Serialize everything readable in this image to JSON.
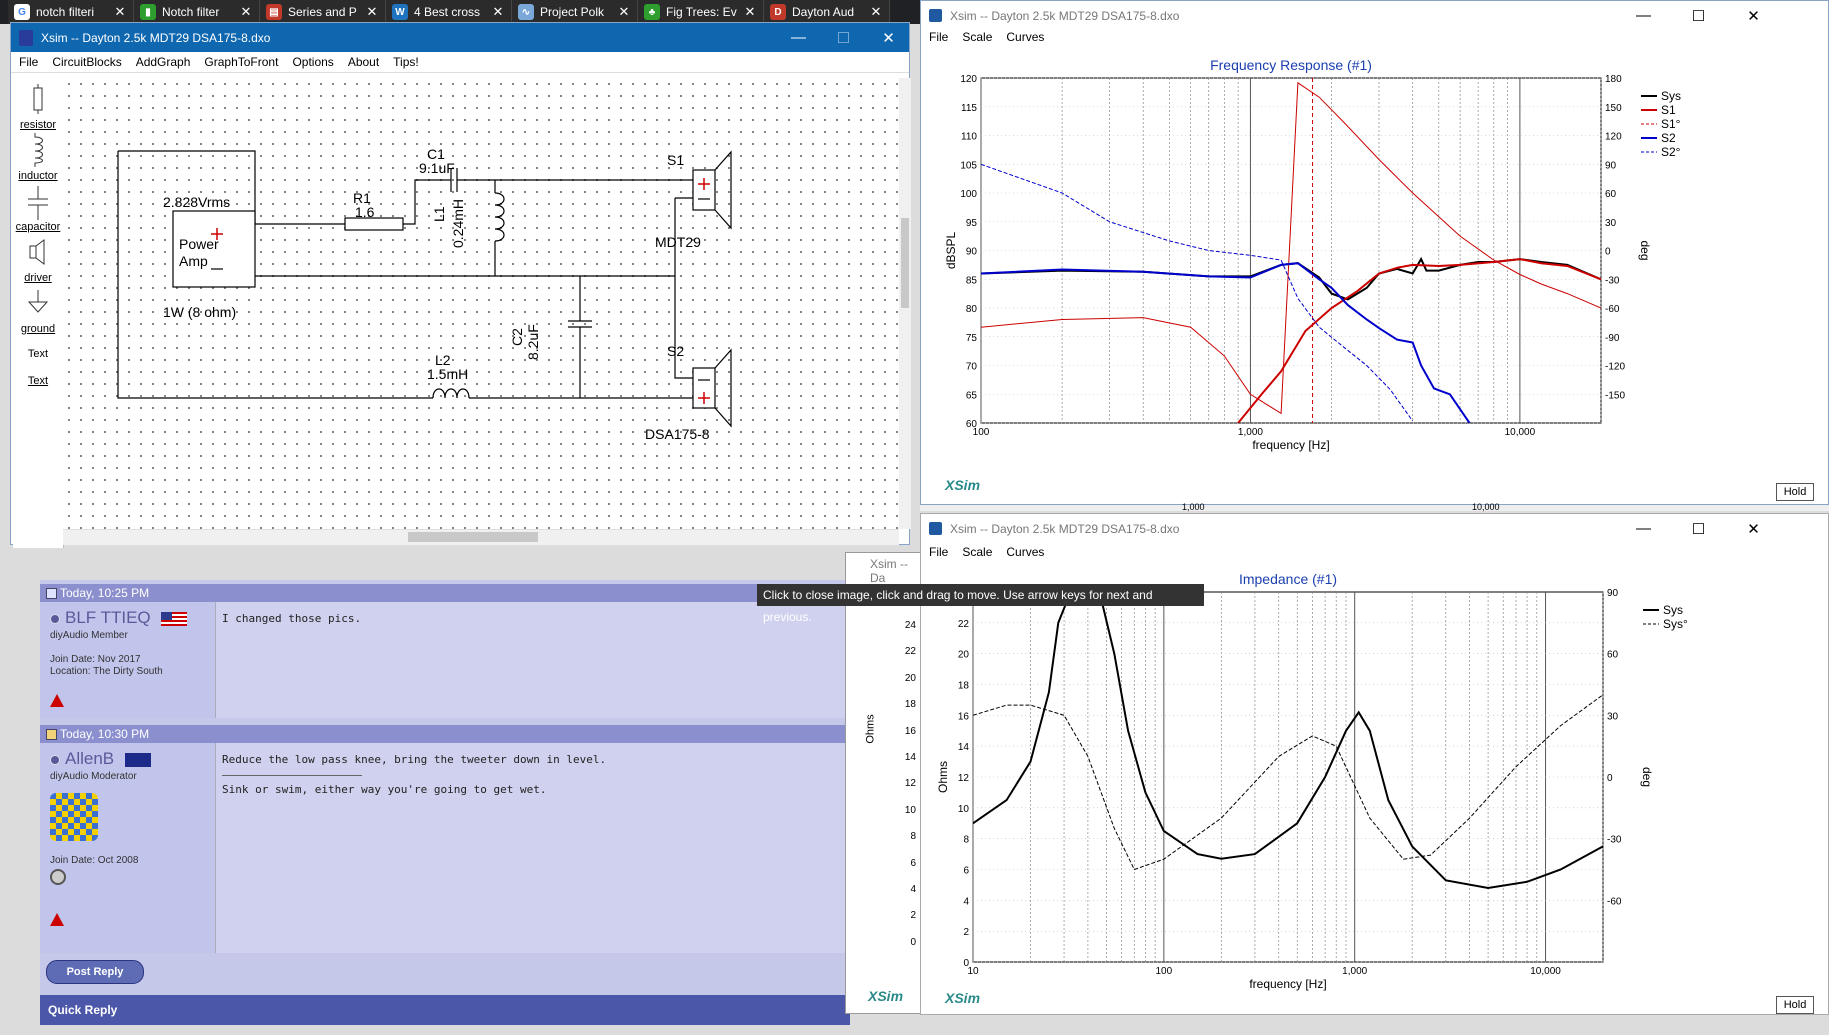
{
  "browser_tabs": [
    {
      "label": "notch filteri",
      "icon": "google-icon",
      "color": "#ffffff"
    },
    {
      "label": "Notch filter",
      "icon": "audio-site-icon",
      "color": "#2e9f2e"
    },
    {
      "label": "Series and P",
      "icon": "site-icon",
      "color": "#c0392b"
    },
    {
      "label": "4 Best cross",
      "icon": "w-icon",
      "color": "#1e73be"
    },
    {
      "label": "Project Polk",
      "icon": "site-icon",
      "color": "#7aa8d8"
    },
    {
      "label": "Fig Trees: Ev",
      "icon": "leaf-icon",
      "color": "#2e9f2e"
    },
    {
      "label": "Dayton Aud",
      "icon": "site-icon",
      "color": "#c0392b"
    }
  ],
  "circuit_window": {
    "title": "Xsim -- Dayton 2.5k MDT29 DSA175-8.dxo",
    "menu": [
      "File",
      "CircuitBlocks",
      "AddGraph",
      "GraphToFront",
      "Options",
      "About",
      "Tips!"
    ],
    "palette": [
      "resistor",
      "inductor",
      "capacitor",
      "driver",
      "ground",
      "Text",
      "Text"
    ],
    "components": {
      "source_voltage": "2.828Vrms",
      "source_name": "Power\nAmp",
      "source_power": "1W (8 ohm)",
      "c1_name": "C1",
      "c1_value": "9.1uF",
      "r1_name": "R1",
      "r1_value": "1.6",
      "l1_name": "L1",
      "l1_value": "0.24mH",
      "c2_name": "C2",
      "c2_value": "8.2uF",
      "l2_name": "L2",
      "l2_value": "1.5mH",
      "s1_name": "S1",
      "s1_model": "MDT29",
      "s2_name": "S2",
      "s2_model": "DSA175-8"
    }
  },
  "forum": {
    "posts": [
      {
        "time": "Today, 10:25 PM",
        "user": "BLF TTIEQ",
        "role": "diyAudio Member",
        "join": "Join Date: Nov 2017",
        "location": "Location: The Dirty South",
        "text": "I changed those pics.",
        "signature": ""
      },
      {
        "time": "Today, 10:30 PM",
        "user": "AllenB",
        "role": "diyAudio Moderator",
        "join": "Join Date: Oct 2008",
        "location": "",
        "text": "Reduce the low pass knee, bring the tweeter down in level.",
        "signature": "Sink or swim, either way you're going to get wet."
      }
    ],
    "post_reply": "Post Reply",
    "quick_reply": "Quick Reply",
    "tooltip": "Click to close image, click and drag to move. Use arrow keys for next and previous."
  },
  "freq_window": {
    "title": "Xsim -- Dayton 2.5k MDT29 DSA175-8.dxo",
    "menu": [
      "File",
      "Scale",
      "Curves"
    ],
    "brand": "XSim",
    "hold": "Hold",
    "behind_ticks": [
      "1,000",
      "10,000"
    ]
  },
  "imp_window": {
    "title": "Xsim -- Dayton 2.5k MDT29 DSA175-8.dxo",
    "menu": [
      "File",
      "Scale",
      "Curves"
    ],
    "brand": "XSim",
    "hold": "Hold",
    "behind_title": "Xsim -- Da",
    "behind_brand": "XSim",
    "behind_yticks": [
      "24",
      "22",
      "20",
      "18",
      "16",
      "14",
      "12",
      "10",
      "8",
      "6",
      "4",
      "2",
      "0"
    ],
    "behind_ylabel": "Ohms"
  },
  "chart_data": [
    {
      "type": "line",
      "title": "Frequency Response (#1)",
      "xlabel": "frequency [Hz]",
      "ylabel": "dBSPL",
      "y2label": "deg",
      "xscale": "log",
      "xlim": [
        100,
        20000
      ],
      "ylim": [
        60,
        120
      ],
      "y2lim": [
        -180,
        180
      ],
      "xticks": [
        "100",
        "1,000",
        "10,000"
      ],
      "yticks": [
        "120",
        "115",
        "110",
        "105",
        "100",
        "95",
        "90",
        "85",
        "80",
        "75",
        "70",
        "65",
        "60"
      ],
      "y2ticks": [
        "180",
        "150",
        "120",
        "90",
        "60",
        "30",
        "0",
        "-30",
        "-60",
        "-90",
        "-120",
        "-150"
      ],
      "legend_position": "top-right",
      "series": [
        {
          "name": "Sys",
          "color": "#000000",
          "axis": "y",
          "style": "solid",
          "x": [
            100,
            200,
            400,
            700,
            1000,
            1300,
            1500,
            1800,
            2000,
            2300,
            2700,
            3000,
            3500,
            4000,
            4300,
            4500,
            5000,
            6000,
            7000,
            8000,
            10000,
            12000,
            15000,
            20000
          ],
          "y": [
            86,
            86.5,
            86.3,
            85.5,
            85.5,
            87.5,
            87.8,
            85.3,
            82.5,
            81.5,
            83.5,
            86,
            86.8,
            86,
            88.5,
            86.5,
            86.5,
            87.5,
            88,
            88,
            88.5,
            88,
            87.5,
            85
          ]
        },
        {
          "name": "S1",
          "color": "#cc0000",
          "axis": "y",
          "style": "solid",
          "x": [
            900,
            1100,
            1300,
            1600,
            2000,
            2500,
            3000,
            3500,
            4000,
            5000,
            6000,
            8000,
            10000,
            12000,
            15000,
            20000
          ],
          "y": [
            60,
            65,
            69,
            76,
            80,
            83,
            86,
            87,
            87.5,
            87.3,
            87.5,
            88,
            88.5,
            87.8,
            87.3,
            85
          ]
        },
        {
          "name": "S1°",
          "color": "#cc0000",
          "axis": "y2",
          "style": "thin",
          "x": [
            100,
            200,
            400,
            600,
            800,
            1000,
            1300,
            1500,
            1800,
            2200,
            3000,
            4000,
            6000,
            8000,
            10000,
            12000,
            15000,
            20000
          ],
          "y": [
            -80,
            -72,
            -70,
            -80,
            -110,
            -150,
            -170,
            175,
            160,
            135,
            95,
            60,
            15,
            -10,
            -25,
            -35,
            -45,
            -60
          ]
        },
        {
          "name": "S2",
          "color": "#0000cc",
          "axis": "y",
          "style": "solid",
          "x": [
            100,
            200,
            400,
            700,
            1000,
            1300,
            1500,
            1800,
            2000,
            2300,
            2700,
            3000,
            3500,
            4000,
            4300,
            4800,
            5500,
            6500
          ],
          "y": [
            86,
            86.7,
            86.3,
            85.5,
            85.3,
            87.5,
            87.8,
            85,
            83.5,
            80.5,
            78,
            76.5,
            74.5,
            74,
            70,
            66,
            65,
            60
          ]
        },
        {
          "name": "S2°",
          "color": "#0000cc",
          "axis": "y2",
          "style": "dashed",
          "x": [
            100,
            200,
            300,
            500,
            700,
            1000,
            1300,
            1500,
            1800,
            2200,
            2700,
            3300,
            4000
          ],
          "y": [
            90,
            60,
            30,
            10,
            0,
            -5,
            -10,
            -50,
            -80,
            -100,
            -120,
            -145,
            -178
          ]
        }
      ],
      "vertical_markers": [
        {
          "x": 1700,
          "color": "#cc0000",
          "style": "dashed"
        }
      ]
    },
    {
      "type": "line",
      "title": "Impedance (#1)",
      "xlabel": "frequency [Hz]",
      "ylabel": "Ohms",
      "y2label": "deg",
      "xscale": "log",
      "xlim": [
        10,
        20000
      ],
      "ylim": [
        0,
        24
      ],
      "y2lim": [
        -90,
        90
      ],
      "xticks": [
        "10",
        "100",
        "1,000",
        "10,000"
      ],
      "yticks": [
        "22",
        "20",
        "18",
        "16",
        "14",
        "12",
        "10",
        "8",
        "6",
        "4",
        "2",
        "0"
      ],
      "y2ticks": [
        "90",
        "60",
        "30",
        "0",
        "-30",
        "-60"
      ],
      "legend_position": "top-right",
      "series": [
        {
          "name": "Sys",
          "color": "#000000",
          "axis": "y",
          "style": "solid",
          "x": [
            10,
            15,
            20,
            25,
            28,
            35,
            45,
            55,
            65,
            80,
            100,
            150,
            200,
            300,
            500,
            700,
            900,
            1050,
            1200,
            1500,
            2000,
            3000,
            5000,
            8000,
            12000,
            20000
          ],
          "y": [
            9,
            10.5,
            13,
            17.5,
            22,
            25,
            24.5,
            20,
            15,
            11,
            8.5,
            7,
            6.7,
            7,
            9,
            12,
            15,
            16.2,
            15,
            10.5,
            7.5,
            5.3,
            4.8,
            5.2,
            6,
            7.5
          ]
        },
        {
          "name": "Sys°",
          "color": "#000000",
          "axis": "y2",
          "style": "dashed",
          "x": [
            10,
            15,
            20,
            30,
            40,
            55,
            70,
            100,
            200,
            400,
            600,
            800,
            1200,
            1800,
            2500,
            4000,
            7000,
            12000,
            20000
          ],
          "y": [
            30,
            35,
            35,
            30,
            10,
            -25,
            -45,
            -40,
            -20,
            10,
            20,
            15,
            -20,
            -40,
            -38,
            -20,
            5,
            25,
            40
          ]
        }
      ]
    }
  ]
}
